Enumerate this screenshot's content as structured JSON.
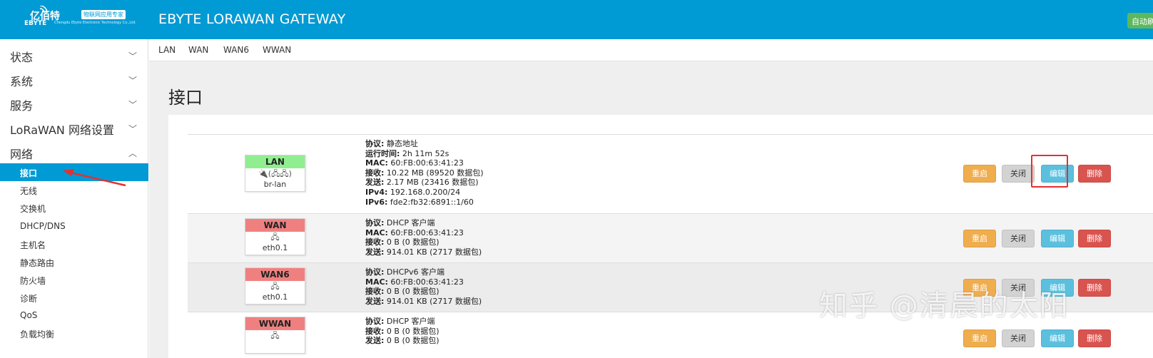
{
  "header": {
    "logo_text": "亿佰特",
    "logo_sub": "EBYTE",
    "logo_tag": "物联网应用专家",
    "logo_tiny": "Chengdu Ebyte Electronic Technology Co.,Ltd.",
    "title": "EBYTE LORAWAN GATEWAY",
    "auto_label": "自动刷新"
  },
  "sidebar": {
    "sections": [
      {
        "label": "状态"
      },
      {
        "label": "系统"
      },
      {
        "label": "服务"
      },
      {
        "label": "LoRaWAN 网络设置"
      },
      {
        "label": "网络"
      }
    ],
    "subitems": [
      "接口",
      "无线",
      "交换机",
      "DHCP/DNS",
      "主机名",
      "静态路由",
      "防火墙",
      "诊断",
      "QoS",
      "负载均衡"
    ]
  },
  "tabs": [
    "LAN",
    "WAN",
    "WAN6",
    "WWAN"
  ],
  "page_title": "接口",
  "buttons": {
    "restart": "重启",
    "stop": "关闭",
    "edit": "编辑",
    "delete": "删除"
  },
  "interfaces": [
    {
      "name": "LAN",
      "color": "#90ee90",
      "device": "br-lan",
      "icons": "🔌(🖧🖧)",
      "info": [
        {
          "k": "协议:",
          "v": " 静态地址"
        },
        {
          "k": "运行时间:",
          "v": " 2h 11m 52s"
        },
        {
          "k": "MAC:",
          "v": " 60:FB:00:63:41:23"
        },
        {
          "k": "接收:",
          "v": " 10.22 MB (89520 数据包)"
        },
        {
          "k": "发送:",
          "v": " 2.17 MB (23416 数据包)"
        },
        {
          "k": "IPv4:",
          "v": " 192.168.0.200/24"
        },
        {
          "k": "IPv6:",
          "v": " fde2:fb32:6891::1/60"
        }
      ]
    },
    {
      "name": "WAN",
      "color": "#f08080",
      "device": "eth0.1",
      "icons": "🖧",
      "info": [
        {
          "k": "协议:",
          "v": " DHCP 客户端"
        },
        {
          "k": "MAC:",
          "v": " 60:FB:00:63:41:23"
        },
        {
          "k": "接收:",
          "v": " 0 B (0 数据包)"
        },
        {
          "k": "发送:",
          "v": " 914.01 KB (2717 数据包)"
        }
      ]
    },
    {
      "name": "WAN6",
      "color": "#f08080",
      "device": "eth0.1",
      "icons": "🖧",
      "info": [
        {
          "k": "协议:",
          "v": " DHCPv6 客户端"
        },
        {
          "k": "MAC:",
          "v": " 60:FB:00:63:41:23"
        },
        {
          "k": "接收:",
          "v": " 0 B (0 数据包)"
        },
        {
          "k": "发送:",
          "v": " 914.01 KB (2717 数据包)"
        }
      ]
    },
    {
      "name": "WWAN",
      "color": "#f08080",
      "device": "",
      "icons": "🖧",
      "info": [
        {
          "k": "协议:",
          "v": " DHCP 客户端"
        },
        {
          "k": "接收:",
          "v": " 0 B (0 数据包)"
        },
        {
          "k": "发送:",
          "v": " 0 B (0 数据包)"
        }
      ]
    }
  ],
  "watermark": "知乎 @清晨的太阳"
}
